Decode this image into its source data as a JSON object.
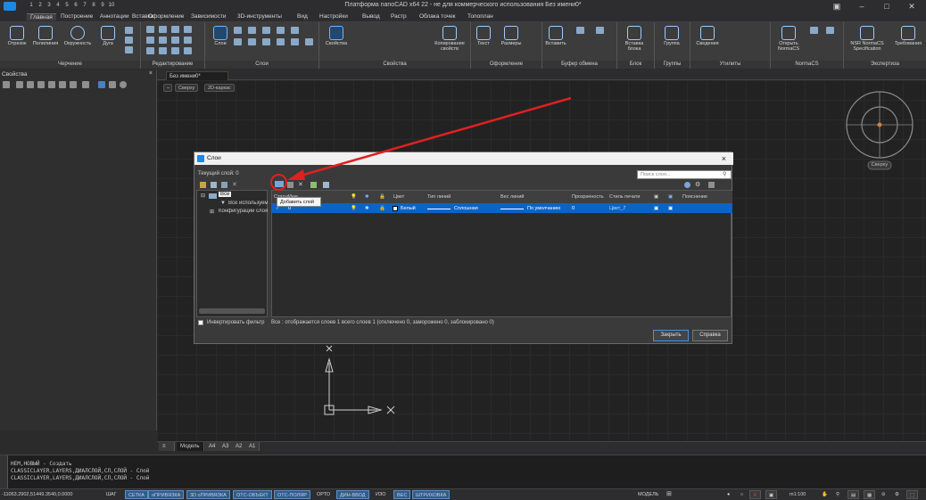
{
  "app": {
    "title": "Платформа nanoCAD x64 22 - не для коммерческого использования Без имени0*",
    "quick_access": [
      "1",
      "2",
      "3",
      "4",
      "5",
      "6",
      "7",
      "8",
      "9",
      "10"
    ]
  },
  "menu": {
    "items": [
      "Главная",
      "Построение",
      "Аннотации",
      "Вставка",
      "Оформление",
      "Зависимости",
      "3D-инструменты",
      "Вид",
      "Настройки",
      "Вывод",
      "Растр",
      "Облака точек",
      "Топоплан"
    ],
    "active": "Главная"
  },
  "ribbon": {
    "groups": [
      {
        "title": "Черчение",
        "buttons": [
          "Отрезок",
          "Полилиния",
          "Окружность",
          "Дуга"
        ]
      },
      {
        "title": "Редактирование",
        "buttons": []
      },
      {
        "title": "Слои",
        "buttons": [
          "Слои"
        ]
      },
      {
        "title": "Свойства",
        "buttons": [
          "Свойства",
          "Копирование свойств"
        ]
      },
      {
        "title": "Оформление",
        "buttons": [
          "Текст",
          "Размеры"
        ]
      },
      {
        "title": "Буфер обмена",
        "buttons": [
          "Вставить"
        ]
      },
      {
        "title": "Блок",
        "buttons": [
          "Вставка блока"
        ]
      },
      {
        "title": "Группы",
        "buttons": [
          "Группа"
        ]
      },
      {
        "title": "Утилиты",
        "buttons": [
          "Сведения"
        ]
      },
      {
        "title": "NormaCS",
        "buttons": [
          "Открыть NormaCS"
        ]
      },
      {
        "title": "Экспертиза",
        "buttons": [
          "NSR NormaCS Specification",
          "Требования"
        ]
      }
    ]
  },
  "props_panel": {
    "title": "Свойства"
  },
  "document": {
    "tab": "Без имени0*",
    "view_buttons": [
      "Сверху",
      "2D-каркас"
    ],
    "viewcube_label": "Сверху",
    "layout_tabs": [
      "Модель",
      "A4",
      "A3",
      "A2",
      "A1"
    ],
    "active_layout": "Модель"
  },
  "dialog": {
    "title": "Слои",
    "current_layer": "Текущий слой: 0",
    "search_placeholder": "Поиск слоя...",
    "tree": {
      "root": "Все",
      "children": [
        "Все используемые...",
        "Конфигурации слоя"
      ]
    },
    "tooltip": "Добавить слой",
    "columns": [
      "Статус",
      "Имя",
      "",
      "",
      "",
      "Цвет",
      "Тип линий",
      "Вес линий",
      "Прозрачность",
      "Стиль печати",
      "",
      "",
      "Пояснение"
    ],
    "rows": [
      {
        "name": "0",
        "color": "Белый",
        "linetype": "Сплошная",
        "lineweight": "По умолчанию",
        "transparency": "0",
        "plotstyle": "Цвет_7"
      }
    ],
    "invert_filter_label": "Инвертировать фильтр",
    "status_text": "Все : отображается слоев 1 всего слоев 1 (отключено 0, заморожено 0, заблокировано 0)",
    "close_button": "Закрыть",
    "help_button": "Справка",
    "close_icon": "×"
  },
  "command_line": {
    "lines": [
      "НЕМ,НОВЫЙ - Создать",
      "CLASSICLAYER,LAYERS,ДИАЛСЛОЙ,СЛ,СЛОЙ - Слой",
      "CLASSICLAYER,LAYERS,ДИАЛСЛОЙ,СЛ,СЛОЙ - Слой"
    ]
  },
  "status_bar": {
    "coords": "-11063.2902,51449.3540,0.0000",
    "toggles": [
      {
        "label": "ШАГ",
        "on": false
      },
      {
        "label": "СЕТКА",
        "on": true
      },
      {
        "label": "оПРИВЯЗКА",
        "on": true
      },
      {
        "label": "3D оПРИВЯЗКА",
        "on": true
      },
      {
        "label": "ОТС-ОБЪЕКТ",
        "on": true
      },
      {
        "label": "ОТС-ПОЛЯР",
        "on": true
      },
      {
        "label": "ОРТО",
        "on": false
      },
      {
        "label": "ДИН-ВВОД",
        "on": true
      },
      {
        "label": "ИЗО",
        "on": false
      },
      {
        "label": "ВЕС",
        "on": true
      },
      {
        "label": "ШТРИХОВКА",
        "on": true
      }
    ],
    "model_label": "МОДЕЛЬ",
    "scale": "m1:100"
  },
  "colors": {
    "accent": "#0a64c8",
    "annotation_red": "#e02020"
  }
}
